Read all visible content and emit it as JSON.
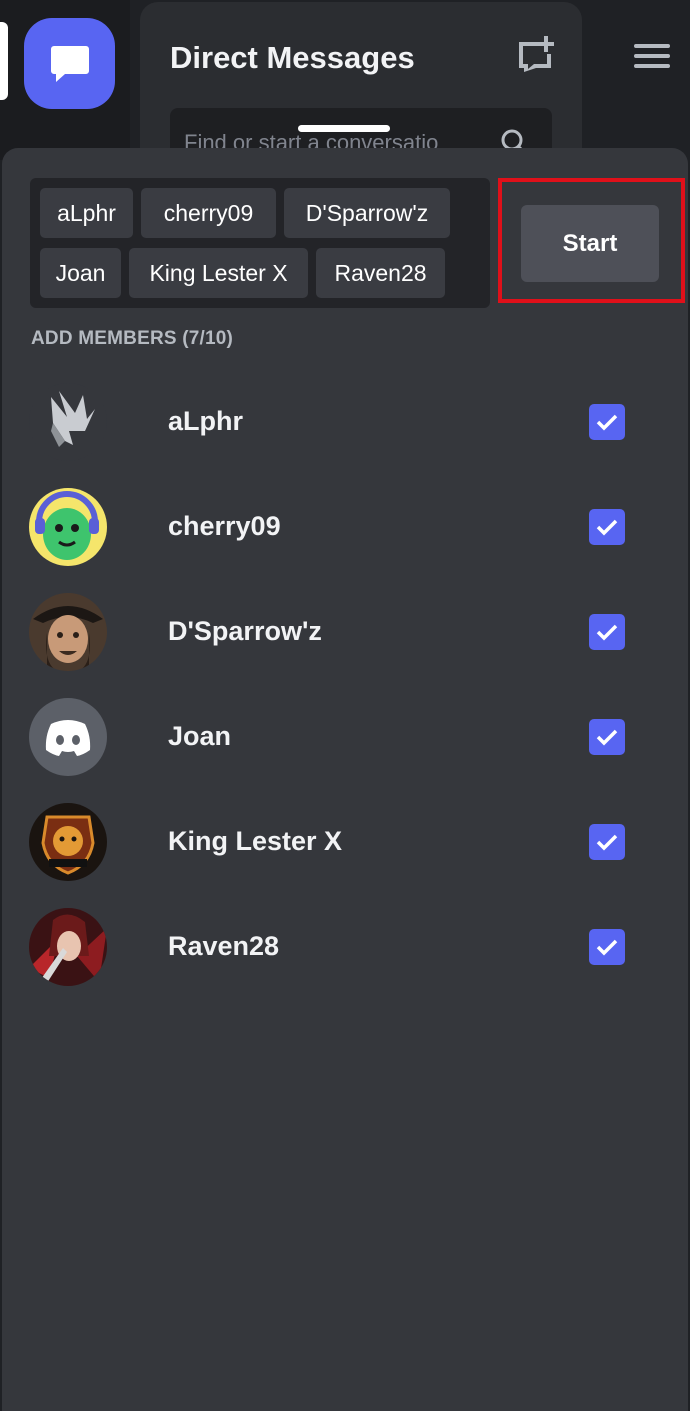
{
  "background": {
    "title": "Direct Messages",
    "search_placeholder": "Find or start a conversatio",
    "icons": {
      "server": "chat-bubble-icon",
      "new_dm": "new-message-icon",
      "menu": "hamburger-icon",
      "search": "search-icon"
    }
  },
  "selected_chips": [
    "aLphr",
    "cherry09",
    "D'Sparrow'z",
    "Joan",
    "King Lester X",
    "Raven28"
  ],
  "start_label": "Start",
  "section_label": "ADD MEMBERS (7/10)",
  "members": [
    {
      "name": "aLphr",
      "checked": true
    },
    {
      "name": "cherry09",
      "checked": true
    },
    {
      "name": "D'Sparrow'z",
      "checked": true
    },
    {
      "name": "Joan",
      "checked": true
    },
    {
      "name": "King Lester X",
      "checked": true
    },
    {
      "name": "Raven28",
      "checked": true
    }
  ],
  "colors": {
    "accent": "#5865f2",
    "highlight": "#e0101a",
    "sheet": "#35373c"
  }
}
